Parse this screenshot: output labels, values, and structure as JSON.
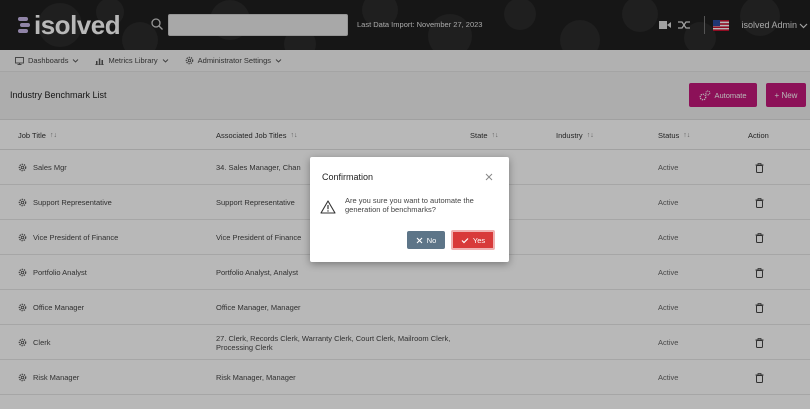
{
  "header": {
    "logo_text": "isolved",
    "import_text": "Last Data Import: November 27, 2023",
    "user_label": "isolved Admin",
    "search": {
      "value": "",
      "placeholder": ""
    }
  },
  "nav": {
    "items": [
      {
        "label": "Dashboards",
        "icon": "monitor-icon"
      },
      {
        "label": "Metrics Library",
        "icon": "bar-chart-icon"
      },
      {
        "label": "Administrator Settings",
        "icon": "gear-icon"
      }
    ]
  },
  "page": {
    "title": "Industry Benchmark List",
    "automate_label": "Automate",
    "new_label": "+ New"
  },
  "table": {
    "columns": [
      "Job Title",
      "Associated Job Titles",
      "State",
      "Industry",
      "Status",
      "Action"
    ],
    "rows": [
      {
        "title": "Sales Mgr",
        "associated": "34. Sales Manager, Chan",
        "status": "Active"
      },
      {
        "title": "Support Representative",
        "associated": "Support Representative",
        "status": "Active"
      },
      {
        "title": "Vice President of Finance",
        "associated": "Vice President of Finance",
        "status": "Active"
      },
      {
        "title": "Portfolio Analyst",
        "associated": "Portfolio Analyst, Analyst",
        "status": "Active"
      },
      {
        "title": "Office Manager",
        "associated": "Office Manager, Manager",
        "status": "Active"
      },
      {
        "title": "Clerk",
        "associated": "27. Clerk, Records Clerk, Warranty Clerk, Court Clerk, Mailroom Clerk, Processing Clerk",
        "status": "Active"
      },
      {
        "title": "Risk Manager",
        "associated": "Risk Manager, Manager",
        "status": "Active"
      }
    ]
  },
  "modal": {
    "title": "Confirmation",
    "message": "Are you sure you want to automate the generation of benchmarks?",
    "no_label": "No",
    "yes_label": "Yes"
  },
  "colors": {
    "accent": "#c2187a",
    "topbar": "#1f1f1f",
    "no_button": "#5d7588",
    "yes_button": "#d83a3a"
  }
}
